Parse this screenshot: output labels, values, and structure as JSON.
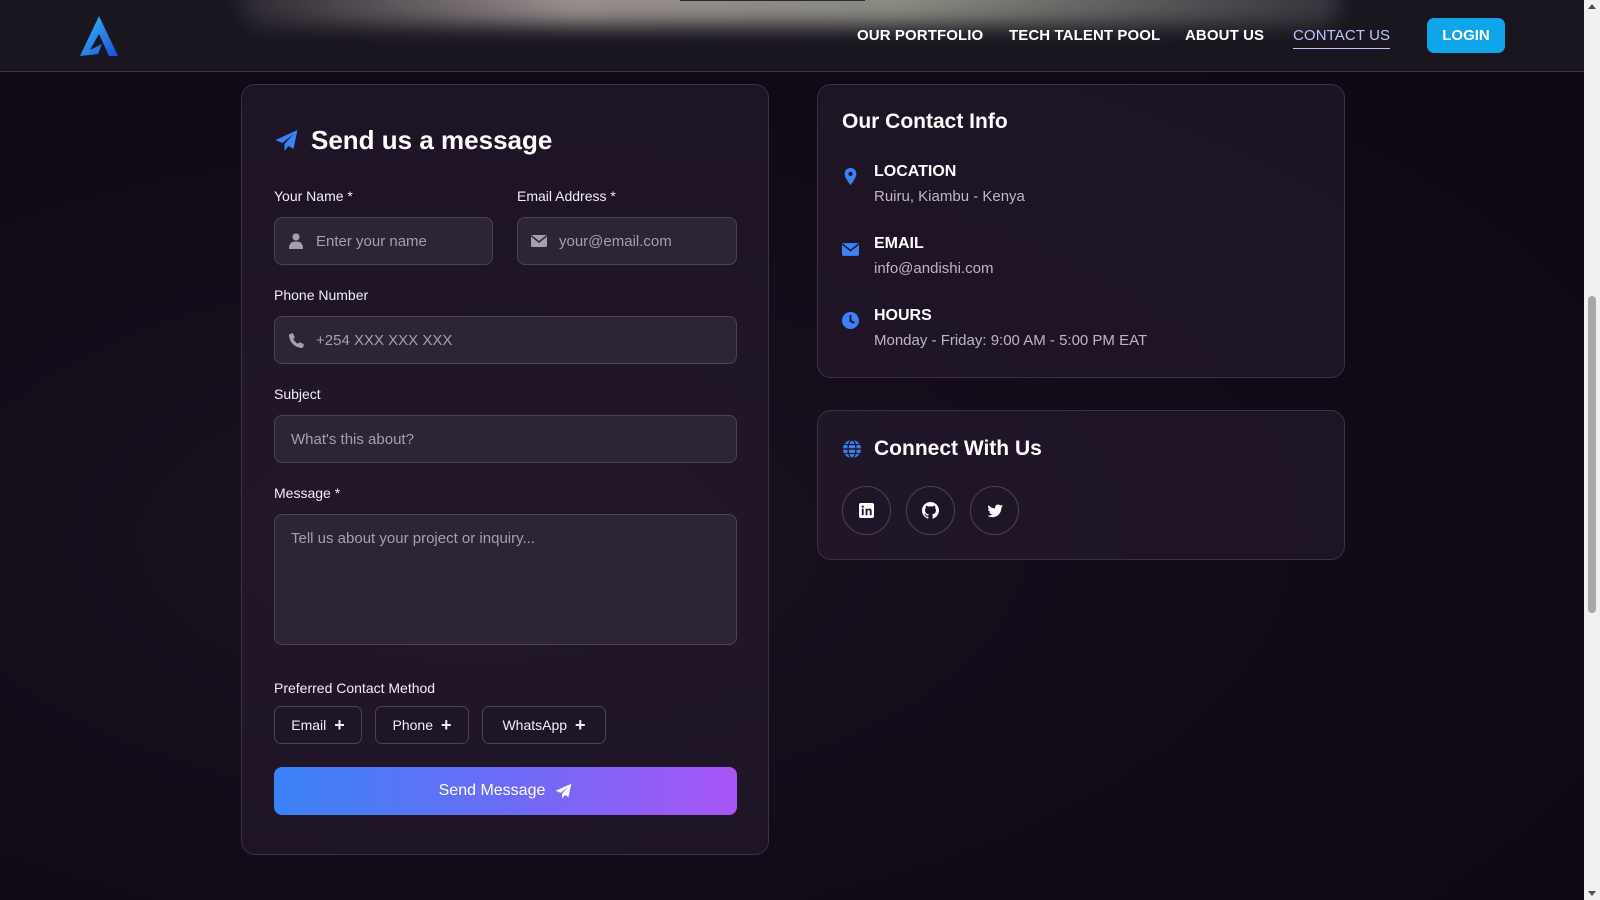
{
  "header": {
    "logo": "andishi-logo",
    "nav": [
      {
        "label": "OUR PORTFOLIO",
        "active": false
      },
      {
        "label": "TECH TALENT POOL",
        "active": false
      },
      {
        "label": "ABOUT US",
        "active": false
      },
      {
        "label": "CONTACT US",
        "active": true
      }
    ],
    "login_label": "LOGIN"
  },
  "form": {
    "title": "Send us a message",
    "name": {
      "label": "Your Name *",
      "placeholder": "Enter your name",
      "icon": "user-icon"
    },
    "email": {
      "label": "Email Address *",
      "placeholder": "your@email.com",
      "icon": "envelope-icon"
    },
    "phone": {
      "label": "Phone Number",
      "placeholder": "+254 XXX XXX XXX",
      "icon": "phone-icon"
    },
    "subject": {
      "label": "Subject",
      "placeholder": "What's this about?"
    },
    "message": {
      "label": "Message *",
      "placeholder": "Tell us about your project or inquiry..."
    },
    "contact_method": {
      "label": "Preferred Contact Method",
      "options": [
        "Email",
        "Phone",
        "WhatsApp"
      ]
    },
    "submit_label": "Send Message"
  },
  "contact_info": {
    "title": "Our Contact Info",
    "items": [
      {
        "heading": "LOCATION",
        "value": "Ruiru, Kiambu - Kenya",
        "icon": "map-pin-icon"
      },
      {
        "heading": "EMAIL",
        "value": "info@andishi.com",
        "icon": "envelope-icon"
      },
      {
        "heading": "HOURS",
        "value": "Monday - Friday: 9:00 AM - 5:00 PM EAT",
        "icon": "clock-icon"
      }
    ]
  },
  "social": {
    "title": "Connect With Us",
    "links": [
      "linkedin-icon",
      "github-icon",
      "twitter-icon"
    ]
  },
  "colors": {
    "accent_blue": "#3b82f6",
    "accent_purple": "#a855f7",
    "login_bg": "#0ea5e9",
    "icon_blue": "#3b82f6"
  }
}
